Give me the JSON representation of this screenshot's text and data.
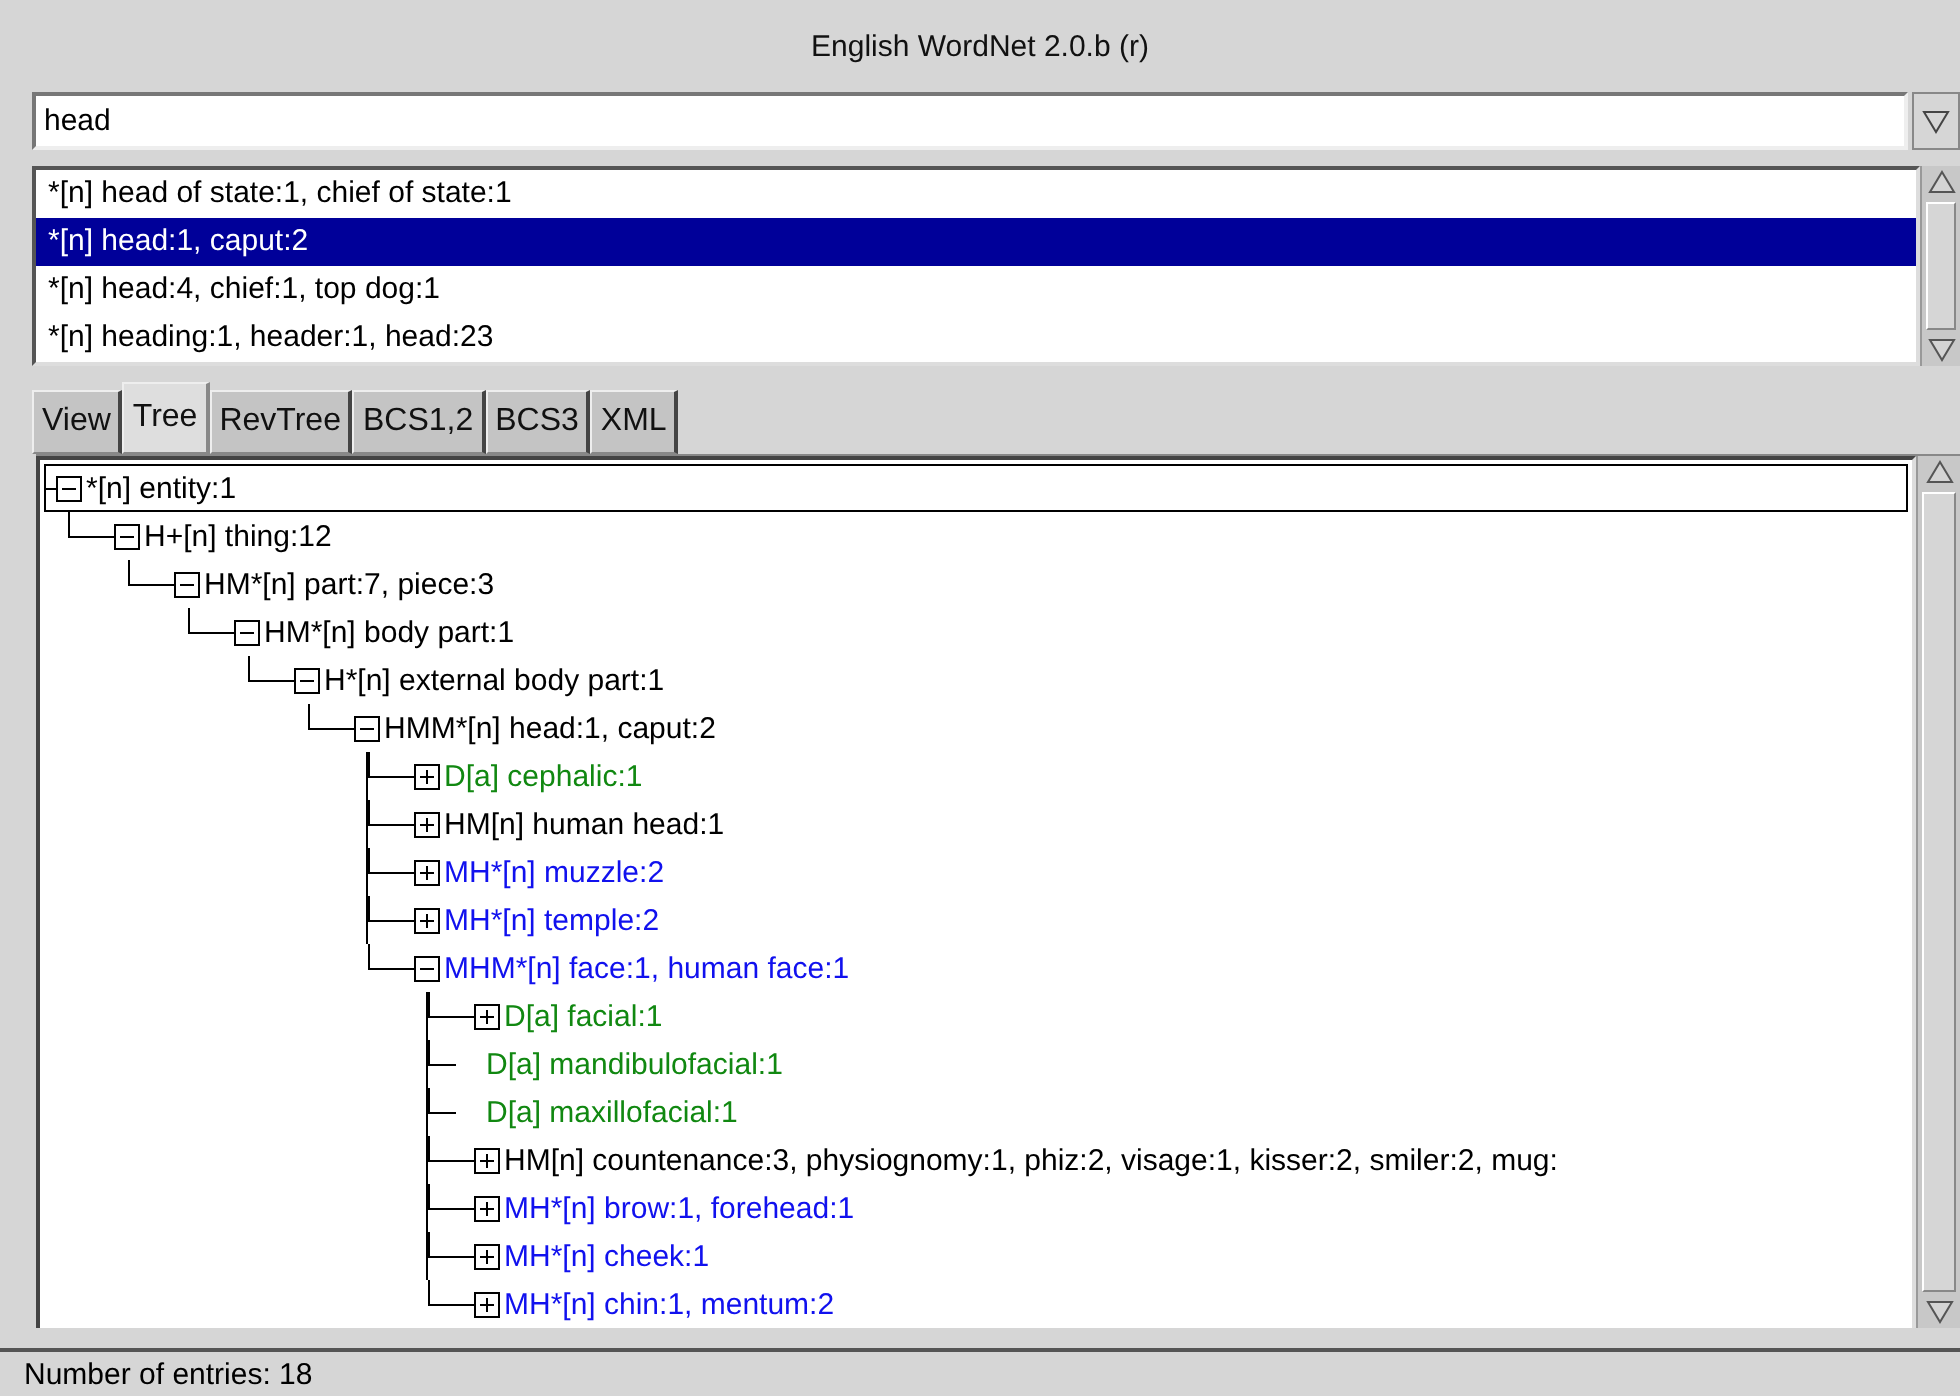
{
  "window": {
    "title": "English WordNet 2.0.b (r)"
  },
  "search": {
    "value": "head"
  },
  "results": [
    {
      "label": "*[n] head of state:1, chief of state:1",
      "selected": false
    },
    {
      "label": "*[n] head:1, caput:2",
      "selected": true
    },
    {
      "label": "*[n] head:4, chief:1, top dog:1",
      "selected": false
    },
    {
      "label": "*[n] heading:1, header:1, head:23",
      "selected": false
    }
  ],
  "tabs": [
    {
      "label": "View",
      "selected": false
    },
    {
      "label": "Tree",
      "selected": true
    },
    {
      "label": "RevTree",
      "selected": false
    },
    {
      "label": "BCS1,2",
      "selected": false
    },
    {
      "label": "BCS3",
      "selected": false
    },
    {
      "label": "XML",
      "selected": false
    }
  ],
  "tree": [
    {
      "label": "*[n] entity:1",
      "kind": "node",
      "expanded": true,
      "selected": true,
      "color": "#000000",
      "children": [
        {
          "label": "H+[n] thing:12",
          "kind": "node",
          "expanded": true,
          "selected": false,
          "color": "#000000",
          "children": [
            {
              "label": "HM*[n] part:7, piece:3",
              "kind": "node",
              "expanded": true,
              "selected": false,
              "color": "#000000",
              "children": [
                {
                  "label": "HM*[n] body part:1",
                  "kind": "node",
                  "expanded": true,
                  "selected": false,
                  "color": "#000000",
                  "children": [
                    {
                      "label": "H*[n] external body part:1",
                      "kind": "node",
                      "expanded": true,
                      "selected": false,
                      "color": "#000000",
                      "children": [
                        {
                          "label": "HMM*[n] head:1, caput:2",
                          "kind": "node",
                          "expanded": true,
                          "selected": false,
                          "color": "#000000",
                          "children": [
                            {
                              "label": "D[a] cephalic:1",
                              "kind": "node",
                              "expanded": false,
                              "selected": false,
                              "color": "#118811"
                            },
                            {
                              "label": "HM[n] human head:1",
                              "kind": "node",
                              "expanded": false,
                              "selected": false,
                              "color": "#000000"
                            },
                            {
                              "label": "MH*[n] muzzle:2",
                              "kind": "node",
                              "expanded": false,
                              "selected": false,
                              "color": "#1111ee"
                            },
                            {
                              "label": "MH*[n] temple:2",
                              "kind": "node",
                              "expanded": false,
                              "selected": false,
                              "color": "#1111ee"
                            },
                            {
                              "label": "MHM*[n] face:1, human face:1",
                              "kind": "node",
                              "expanded": true,
                              "selected": false,
                              "color": "#1111ee",
                              "children": [
                                {
                                  "label": "D[a] facial:1",
                                  "kind": "node",
                                  "expanded": false,
                                  "selected": false,
                                  "color": "#118811"
                                },
                                {
                                  "label": "D[a] mandibulofacial:1",
                                  "kind": "leaf",
                                  "selected": false,
                                  "color": "#118811"
                                },
                                {
                                  "label": "D[a] maxillofacial:1",
                                  "kind": "leaf",
                                  "selected": false,
                                  "color": "#118811"
                                },
                                {
                                  "label": "HM[n] countenance:3, physiognomy:1, phiz:2, visage:1, kisser:2, smiler:2, mug:",
                                  "kind": "node",
                                  "expanded": false,
                                  "selected": false,
                                  "color": "#000000"
                                },
                                {
                                  "label": "MH*[n] brow:1, forehead:1",
                                  "kind": "node",
                                  "expanded": false,
                                  "selected": false,
                                  "color": "#1111ee"
                                },
                                {
                                  "label": "MH*[n] cheek:1",
                                  "kind": "node",
                                  "expanded": false,
                                  "selected": false,
                                  "color": "#1111ee"
                                },
                                {
                                  "label": "MH*[n] chin:1, mentum:2",
                                  "kind": "node",
                                  "expanded": false,
                                  "selected": false,
                                  "color": "#1111ee"
                                }
                              ]
                            }
                          ]
                        }
                      ]
                    }
                  ]
                }
              ]
            }
          ]
        }
      ]
    }
  ],
  "status_bar": {
    "text": "Number of entries: 18"
  }
}
